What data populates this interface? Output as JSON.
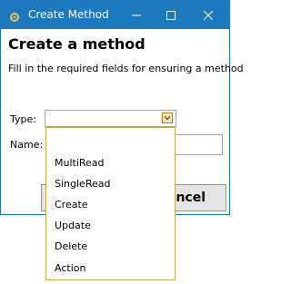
{
  "window": {
    "title": "Create Method",
    "heading": "Create a method",
    "subtitle": "Fill in the required fields for ensuring a method"
  },
  "titlebar": {
    "minimize_icon": "minimize-icon",
    "maximize_icon": "maximize-icon",
    "close_icon": "close-icon"
  },
  "form": {
    "type_label": "Type:",
    "name_label": "Name:",
    "type_value": "",
    "name_value": ""
  },
  "dropdown": {
    "options": [
      "MultiRead",
      "SingleRead",
      "Create",
      "Update",
      "Delete",
      "Action"
    ]
  },
  "buttons": {
    "cancel_label": "ancel"
  },
  "colors": {
    "titlebar": "#1c79c0",
    "dropdown_border": "#c9a54d",
    "dropdown_button": "#fde8bf"
  }
}
